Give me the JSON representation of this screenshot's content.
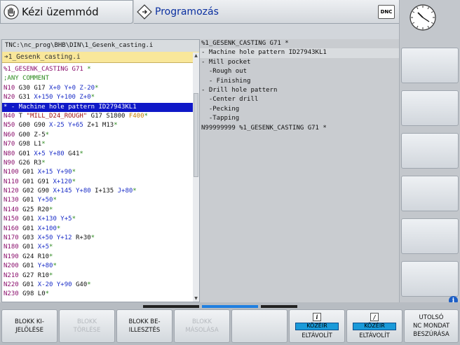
{
  "header": {
    "mode_manual": "Kézi üzemmód",
    "mode_program": "Programozás",
    "dnc_label": "DNC"
  },
  "program": {
    "path": "TNC:\\nc_prog\\BHB\\DIN\\1_Gesenk_casting.i",
    "file": "➔1_Gesenk_casting.i",
    "lines": [
      {
        "parts": [
          [
            "n",
            "%1_GESENK_CASTING G71 "
          ],
          [
            "g",
            "*"
          ]
        ]
      },
      {
        "parts": [
          [
            "g",
            ";ANY COMMENT"
          ]
        ]
      },
      {
        "parts": [
          [
            "n",
            "N10"
          ],
          [
            "t",
            " G30 G17 "
          ],
          [
            "b",
            "X+0"
          ],
          [
            "t",
            " "
          ],
          [
            "b",
            "Y+0"
          ],
          [
            "t",
            " "
          ],
          [
            "b",
            "Z-20"
          ],
          [
            "g",
            "*"
          ]
        ]
      },
      {
        "parts": [
          [
            "n",
            "N20"
          ],
          [
            "t",
            " G31 "
          ],
          [
            "b",
            "X+150"
          ],
          [
            "t",
            " "
          ],
          [
            "b",
            "Y+100"
          ],
          [
            "t",
            " "
          ],
          [
            "b",
            "Z+0"
          ],
          [
            "g",
            "*"
          ]
        ]
      },
      {
        "sel": true,
        "parts": [
          [
            "t",
            "* - Machine hole pattern ID27943KL1"
          ]
        ]
      },
      {
        "parts": [
          [
            "n",
            "N40"
          ],
          [
            "t",
            " T "
          ],
          [
            "s",
            "\"MILL_D24_ROUGH\""
          ],
          [
            "t",
            " G17 S1800 "
          ],
          [
            "o",
            "F400"
          ],
          [
            "g",
            "*"
          ]
        ]
      },
      {
        "parts": [
          [
            "n",
            "N50"
          ],
          [
            "t",
            " G00 G90 "
          ],
          [
            "b",
            "X-25"
          ],
          [
            "t",
            " "
          ],
          [
            "b",
            "Y+65"
          ],
          [
            "t",
            " Z+1 M13"
          ],
          [
            "g",
            "*"
          ]
        ]
      },
      {
        "parts": [
          [
            "n",
            "N60"
          ],
          [
            "t",
            " G00 Z-5"
          ],
          [
            "g",
            "*"
          ]
        ]
      },
      {
        "parts": [
          [
            "n",
            "N70"
          ],
          [
            "t",
            " G98 L1"
          ],
          [
            "g",
            "*"
          ]
        ]
      },
      {
        "parts": [
          [
            "n",
            "N80"
          ],
          [
            "t",
            " G01 "
          ],
          [
            "b",
            "X+5"
          ],
          [
            "t",
            " "
          ],
          [
            "b",
            "Y+80"
          ],
          [
            "t",
            " G41"
          ],
          [
            "g",
            "*"
          ]
        ]
      },
      {
        "parts": [
          [
            "n",
            "N90"
          ],
          [
            "t",
            " G26 R3"
          ],
          [
            "g",
            "*"
          ]
        ]
      },
      {
        "parts": [
          [
            "n",
            "N100"
          ],
          [
            "t",
            " G01 "
          ],
          [
            "b",
            "X+15"
          ],
          [
            "t",
            " "
          ],
          [
            "b",
            "Y+90"
          ],
          [
            "g",
            "*"
          ]
        ]
      },
      {
        "parts": [
          [
            "n",
            "N110"
          ],
          [
            "t",
            " G01 G91 "
          ],
          [
            "b",
            "X+120"
          ],
          [
            "g",
            "*"
          ]
        ]
      },
      {
        "parts": [
          [
            "n",
            "N120"
          ],
          [
            "t",
            " G02 G90 "
          ],
          [
            "b",
            "X+145"
          ],
          [
            "t",
            " "
          ],
          [
            "b",
            "Y+80"
          ],
          [
            "t",
            " I+135 "
          ],
          [
            "b",
            "J+80"
          ],
          [
            "g",
            "*"
          ]
        ]
      },
      {
        "parts": [
          [
            "n",
            "N130"
          ],
          [
            "t",
            " G01 "
          ],
          [
            "b",
            "Y+50"
          ],
          [
            "g",
            "*"
          ]
        ]
      },
      {
        "parts": [
          [
            "n",
            "N140"
          ],
          [
            "t",
            " G25 R20"
          ],
          [
            "g",
            "*"
          ]
        ]
      },
      {
        "parts": [
          [
            "n",
            "N150"
          ],
          [
            "t",
            " G01 "
          ],
          [
            "b",
            "X+130"
          ],
          [
            "t",
            " "
          ],
          [
            "b",
            "Y+5"
          ],
          [
            "g",
            "*"
          ]
        ]
      },
      {
        "parts": [
          [
            "n",
            "N160"
          ],
          [
            "t",
            " G01 "
          ],
          [
            "b",
            "X+100"
          ],
          [
            "g",
            "*"
          ]
        ]
      },
      {
        "parts": [
          [
            "n",
            "N170"
          ],
          [
            "t",
            " G03 "
          ],
          [
            "b",
            "X+50"
          ],
          [
            "t",
            " "
          ],
          [
            "b",
            "Y+12"
          ],
          [
            "t",
            " R+30"
          ],
          [
            "g",
            "*"
          ]
        ]
      },
      {
        "parts": [
          [
            "n",
            "N180"
          ],
          [
            "t",
            " G01 "
          ],
          [
            "b",
            "X+5"
          ],
          [
            "g",
            "*"
          ]
        ]
      },
      {
        "parts": [
          [
            "n",
            "N190"
          ],
          [
            "t",
            " G24 R10"
          ],
          [
            "g",
            "*"
          ]
        ]
      },
      {
        "parts": [
          [
            "n",
            "N200"
          ],
          [
            "t",
            " G01 "
          ],
          [
            "b",
            "Y+80"
          ],
          [
            "g",
            "*"
          ]
        ]
      },
      {
        "parts": [
          [
            "n",
            "N210"
          ],
          [
            "t",
            " G27 R10"
          ],
          [
            "g",
            "*"
          ]
        ]
      },
      {
        "parts": [
          [
            "n",
            "N220"
          ],
          [
            "t",
            " G01 "
          ],
          [
            "b",
            "X-20"
          ],
          [
            "t",
            " "
          ],
          [
            "b",
            "Y+90"
          ],
          [
            "t",
            " G40"
          ],
          [
            "g",
            "*"
          ]
        ]
      },
      {
        "parts": [
          [
            "n",
            "N230"
          ],
          [
            "t",
            " G98 L0"
          ],
          [
            "g",
            "*"
          ]
        ]
      }
    ]
  },
  "structure": [
    {
      "text": "%1_GESENK_CASTING G71 *"
    },
    {
      "text": "- Machine hole pattern ID27943KL1",
      "hl": true
    },
    {
      "text": "- Mill pocket"
    },
    {
      "text": "  -Rough out"
    },
    {
      "text": "  - Finishing"
    },
    {
      "text": "- Drill hole pattern"
    },
    {
      "text": "  -Center drill"
    },
    {
      "text": "  -Pecking"
    },
    {
      "text": "  -Tapping"
    },
    {
      "text": "N99999999 %1_GESENK_CASTING G71 *"
    }
  ],
  "softkeys": [
    {
      "line1": "BLOKK KI-",
      "line2": "JELÖLÉSE",
      "enabled": true
    },
    {
      "line1": "BLOKK",
      "line2": "TÖRLÉSE",
      "enabled": false
    },
    {
      "line1": "BLOKK BE-",
      "line2": "ILLESZTÉS",
      "enabled": true
    },
    {
      "line1": "BLOKK",
      "line2": "MÁSOLÁSA",
      "enabled": false
    },
    {
      "line1": "",
      "line2": "",
      "enabled": true
    },
    {
      "toggle": "KÖZÉIR",
      "line2": "ELTÁVOLÍT",
      "icon": "i",
      "enabled": true
    },
    {
      "toggle": "KÖZÉIR",
      "line2": "ELTÁVOLÍT",
      "icon": "/",
      "enabled": true
    },
    {
      "line1": "UTOLSÓ",
      "line2": "NC MONDAT",
      "line3": "BESZÚRÁSA",
      "enabled": true
    }
  ],
  "colors": {
    "selection": "#0f18c8",
    "file_bar": "#f9e79a",
    "program_mode_text": "#0a2fa0"
  }
}
